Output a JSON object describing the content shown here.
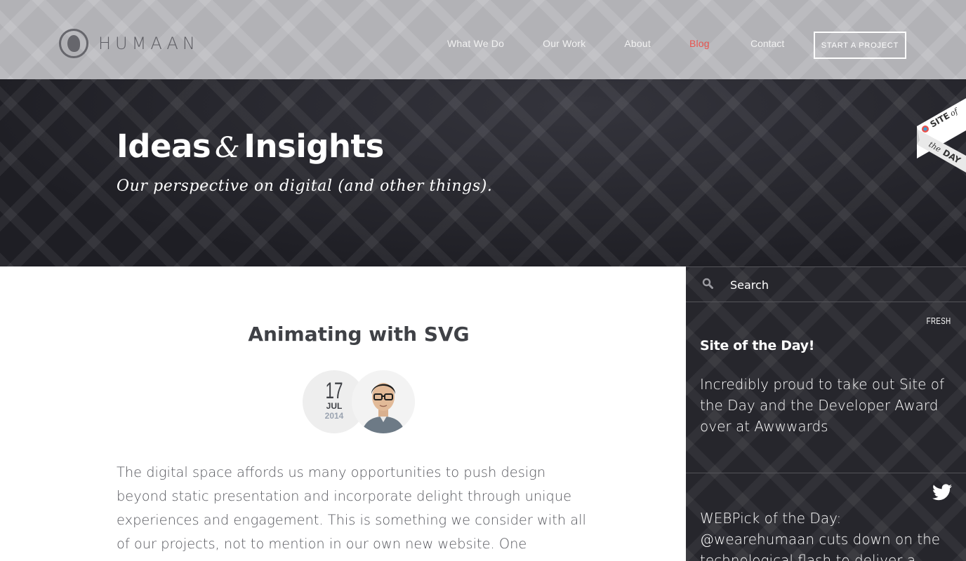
{
  "header": {
    "logo_text": "HUMAAN",
    "nav": [
      {
        "label": "What We Do"
      },
      {
        "label": "Our Work"
      },
      {
        "label": "About"
      },
      {
        "label": "Blog",
        "active": true
      },
      {
        "label": "Contact"
      }
    ],
    "cta_label": "START A PROJECT"
  },
  "hero": {
    "title_part1": "Ideas",
    "title_amp": "&",
    "title_part2": "Insights",
    "subtitle": "Our perspective on digital (and other things)."
  },
  "ribbon": {
    "line1_a": "SITE",
    "line1_b": "of",
    "line2_a": "the",
    "line2_b": "DAY"
  },
  "article": {
    "title": "Animating with SVG",
    "date_day": "17",
    "date_month": "JUL",
    "date_year": "2014",
    "body": "The digital space affords us many opportunities to push design beyond static presentation and incorporate delight through unique experiences and engagement. This is something we consider with all of our projects, not to mention in our own new website. One component in particular"
  },
  "sidebar": {
    "search_placeholder": "Search",
    "fresh_tag": "FRESH",
    "feature_title": "Site of the Day!",
    "feature_text": "Incredibly proud to take out Site of the Day and the Developer Award over at Awwwards",
    "tweet_text": "WEBPick of the Day: @wearehumaan cuts down on the technological flash to deliver a"
  },
  "colors": {
    "accent": "#e8534e",
    "dark": "#26262c",
    "text": "#55565c"
  }
}
